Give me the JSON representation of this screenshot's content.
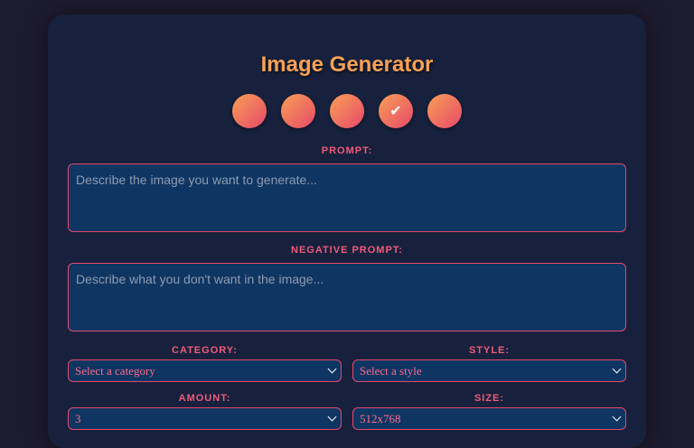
{
  "app": {
    "title": "Image Generator"
  },
  "toolbar": {
    "icons": [
      {
        "name": "image-icon",
        "glyph": ""
      },
      {
        "name": "history-icon",
        "glyph": ""
      },
      {
        "name": "settings-icon",
        "glyph": ""
      },
      {
        "name": "check-icon",
        "glyph": "✔"
      },
      {
        "name": "share-icon",
        "glyph": ""
      }
    ]
  },
  "form": {
    "prompt": {
      "label": "PROMPT:",
      "placeholder": "Describe the image you want to generate...",
      "value": ""
    },
    "negative_prompt": {
      "label": "NEGATIVE PROMPT:",
      "placeholder": "Describe what you don't want in the image...",
      "value": ""
    },
    "category": {
      "label": "CATEGORY:",
      "selected": "Select a category"
    },
    "style": {
      "label": "STYLE:",
      "selected": "Select a style"
    },
    "amount": {
      "label": "AMOUNT:",
      "selected": "3"
    },
    "size": {
      "label": "SIZE:",
      "selected": "512x768"
    }
  },
  "colors": {
    "accent_orange": "#f7a055",
    "accent_pink": "#e8486a",
    "card_bg": "#17213d",
    "field_bg": "#0f3562"
  }
}
